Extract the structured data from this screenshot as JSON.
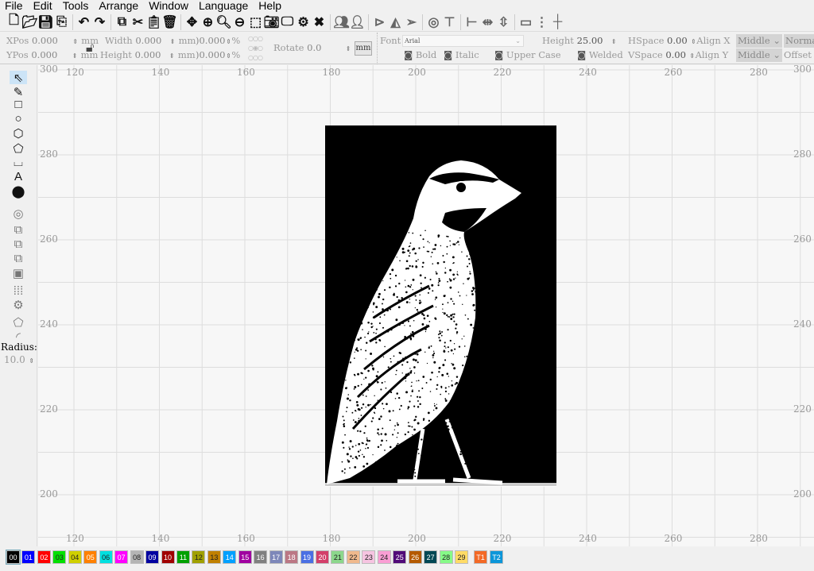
{
  "menu": [
    "File",
    "Edit",
    "Tools",
    "Arrange",
    "Window",
    "Language",
    "Help"
  ],
  "toolbar_icons": [
    "new-file-icon",
    "open-folder-icon",
    "save-icon",
    "import-icon",
    "undo-icon",
    "redo-icon",
    "copy-icon",
    "cut-icon",
    "paste-icon",
    "delete-icon",
    "move-icon",
    "zoom-fit-icon",
    "zoom-in-icon",
    "zoom-out-icon",
    "select-frame-icon",
    "camera-icon",
    "monitor-icon",
    "settings-icon",
    "tools-icon",
    "group-icon",
    "user-icon",
    "flip-icon",
    "mirror-icon",
    "send-icon",
    "target-icon",
    "align-top-icon",
    "align-left-icon",
    "distribute-h-icon",
    "distribute-v-icon",
    "resize-icon",
    "space-icon",
    "center-icon"
  ],
  "props": {
    "xpos_label": "XPos",
    "xpos": "0.000",
    "ypos_label": "YPos",
    "ypos": "0.000",
    "unit": "mm",
    "width_label": "Width",
    "width": "0.000",
    "height_label": "Height",
    "height": "0.000",
    "scale_x": ")0.000",
    "scale_y": ")0.000",
    "percent": "%",
    "rotate_label": "Rotate",
    "rotate": "0.0",
    "unit_button": "mm",
    "font_label": "Font",
    "font": "Arial",
    "text_height_label": "Height",
    "text_height": "25.00",
    "hspace_label": "HSpace",
    "hspace": "0.00",
    "vspace_label": "VSpace",
    "vspace": "0.00",
    "align_x_label": "Align X",
    "align_x": "Middle",
    "align_y_label": "Align Y",
    "align_y": "Middle",
    "normal": "Normal",
    "offset": "Offset",
    "bold": "Bold",
    "italic": "Italic",
    "upper_case": "Upper Case",
    "welded": "Welded"
  },
  "left_tools": [
    "select-icon",
    "pen-icon",
    "rectangle-icon",
    "ellipse-icon",
    "polygon-icon",
    "shape-icon",
    "frame-icon",
    "text-icon",
    "position-icon",
    "offset-icon",
    "boolean-union-icon",
    "boolean-subtract-icon",
    "boolean-intersect-icon",
    "boolean-inner-icon",
    "grid-array-icon",
    "circular-array-icon",
    "corner-icon",
    "fillet-icon"
  ],
  "radius_label": "Radius:",
  "radius": "10.0",
  "x_ticks": [
    "120",
    "140",
    "160",
    "180",
    "200",
    "220",
    "240",
    "260",
    "280"
  ],
  "y_ticks": [
    "300",
    "280",
    "260",
    "240",
    "220",
    "200"
  ],
  "palette": [
    {
      "l": "00",
      "c": "#000000"
    },
    {
      "l": "01",
      "c": "#0000ff"
    },
    {
      "l": "02",
      "c": "#ff0000"
    },
    {
      "l": "03",
      "c": "#00e000"
    },
    {
      "l": "04",
      "c": "#d0d000"
    },
    {
      "l": "05",
      "c": "#ff8000"
    },
    {
      "l": "06",
      "c": "#00e0e0"
    },
    {
      "l": "07",
      "c": "#ff00ff"
    },
    {
      "l": "08",
      "c": "#b4b4b4"
    },
    {
      "l": "09",
      "c": "#0000a0"
    },
    {
      "l": "10",
      "c": "#a00000"
    },
    {
      "l": "11",
      "c": "#00a000"
    },
    {
      "l": "12",
      "c": "#a0a000"
    },
    {
      "l": "13",
      "c": "#c08000"
    },
    {
      "l": "14",
      "c": "#00a0ff"
    },
    {
      "l": "15",
      "c": "#a000a0"
    },
    {
      "l": "16",
      "c": "#808080"
    },
    {
      "l": "17",
      "c": "#7d87b9"
    },
    {
      "l": "18",
      "c": "#bb7784"
    },
    {
      "l": "19",
      "c": "#4a6fe3"
    },
    {
      "l": "20",
      "c": "#d33f6a"
    },
    {
      "l": "21",
      "c": "#8cd78c"
    },
    {
      "l": "22",
      "c": "#f0b98d"
    },
    {
      "l": "23",
      "c": "#f6c4e1"
    },
    {
      "l": "24",
      "c": "#fa9ed4"
    },
    {
      "l": "25",
      "c": "#500a78"
    },
    {
      "l": "26",
      "c": "#b45a00"
    },
    {
      "l": "27",
      "c": "#004754"
    },
    {
      "l": "28",
      "c": "#86fa88"
    },
    {
      "l": "29",
      "c": "#ffdb66"
    },
    {
      "l": "T1",
      "c": "#f36926"
    },
    {
      "l": "T2",
      "c": "#0c96d9"
    }
  ]
}
